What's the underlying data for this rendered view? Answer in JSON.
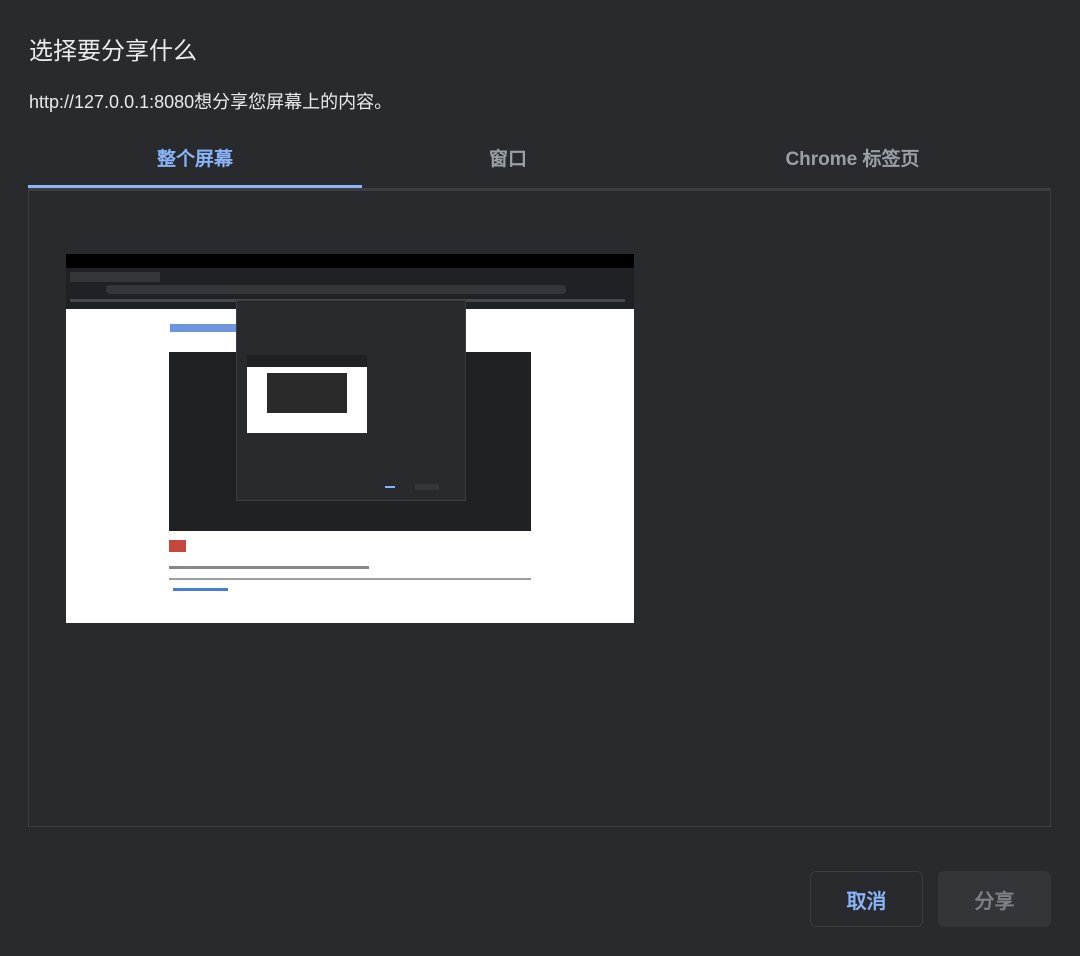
{
  "dialog": {
    "title": "选择要分享什么",
    "subtitle": "http://127.0.0.1:8080想分享您屏幕上的内容。"
  },
  "tabs": [
    {
      "label": "整个屏幕",
      "active": true
    },
    {
      "label": "窗口",
      "active": false
    },
    {
      "label": "Chrome 标签页",
      "active": false
    }
  ],
  "buttons": {
    "cancel": "取消",
    "share": "分享"
  },
  "colors": {
    "background": "#292a2d",
    "accent": "#8ab4f8",
    "share_disabled_bg": "#343538"
  },
  "screen_thumbnail": {
    "description_icon": "screen-preview"
  }
}
